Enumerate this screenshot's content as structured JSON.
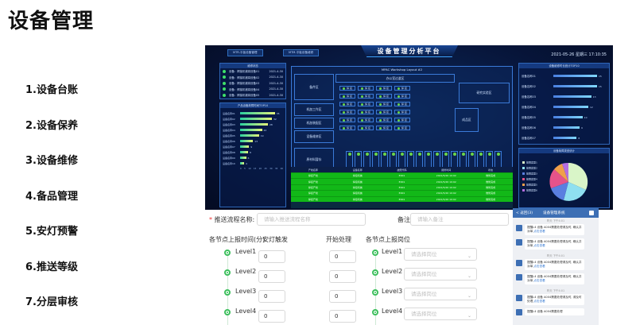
{
  "page_title": "设备管理",
  "menu": [
    "1.设备台账",
    "2.设备保养",
    "3.设备维修",
    "4.备品管理",
    "5.安灯预警",
    "6.推送等级",
    "7.分层审核"
  ],
  "dashboard": {
    "title": "设备管理分析平台",
    "tabs": [
      "MTR-平板设备管理",
      "MTM-平板设备维修"
    ],
    "datetime": "2021-05-26  星期三  17:10:35",
    "left_panel_title": "维修状态",
    "left_rows": [
      {
        "name": "设备：焊接机械臂设备01",
        "date": "2021-4-30"
      },
      {
        "name": "设备：焊接机械臂设备02",
        "date": "2021-4-30"
      },
      {
        "name": "设备：焊接机械臂设备03",
        "date": "2021-4-30"
      },
      {
        "name": "设备：焊接机械臂设备04",
        "date": "2021-4-30"
      },
      {
        "name": "设备：焊接机械臂设备05",
        "date": "2021-4-30"
      }
    ],
    "bar_panel_title": "产品设备故障时间TOP10",
    "bars": [
      {
        "label": "设备名称01",
        "value": 35
      },
      {
        "label": "设备名称02",
        "value": 32
      },
      {
        "label": "设备名称03",
        "value": 28
      },
      {
        "label": "设备名称04",
        "value": 22
      },
      {
        "label": "设备名称05",
        "value": 19
      },
      {
        "label": "设备名称06",
        "value": 13
      },
      {
        "label": "设备名称07",
        "value": 9
      },
      {
        "label": "设备名称08",
        "value": 8
      },
      {
        "label": "设备名称09",
        "value": 6
      },
      {
        "label": "设备名称10",
        "value": 4
      }
    ],
    "bar_axis": [
      "0",
      "5",
      "10",
      "15",
      "20",
      "25",
      "30",
      "35",
      "40"
    ],
    "floor_title": "MPAC Workshop Layout #2",
    "floor_sub": "办公室过道区",
    "zones": [
      "备件区",
      "机加工作区",
      "机加装配区",
      "设备维修区",
      "原材料暂存",
      "成品区",
      "研究实验区"
    ],
    "eq_label": "焊 接",
    "table_title": "设备维修记录",
    "table_head": [
      "产线名称",
      "设备名称",
      "故障代码",
      "报修时间",
      "状态"
    ],
    "table_rows": [
      [
        "焊接产线",
        "焊接机械",
        "E001",
        "2021/5/26 10:02",
        "维修完成"
      ],
      [
        "焊接产线",
        "焊接机械",
        "E001",
        "2021/5/26 10:02",
        "维修完成"
      ],
      [
        "焊接产线",
        "焊接机械",
        "E001",
        "2021/5/26 10:02",
        "维修完成"
      ],
      [
        "焊接产线",
        "焊接机械",
        "E001",
        "2021/5/26 10:02",
        "维修完成"
      ],
      [
        "焊接产线",
        "焊接机械",
        "E001",
        "2021/5/26 10:02",
        "维修完成"
      ]
    ],
    "right_panel_title": "设备维修时长统计TOP10",
    "right_rows": [
      {
        "name": "设备名称01",
        "val": "15"
      },
      {
        "name": "设备名称02",
        "val": "15"
      },
      {
        "name": "设备名称03",
        "val": "13"
      },
      {
        "name": "设备名称04",
        "val": "12"
      },
      {
        "name": "设备名称05",
        "val": "10"
      },
      {
        "name": "设备名称06",
        "val": "9"
      },
      {
        "name": "设备名称07",
        "val": "8"
      }
    ],
    "pie_title": "设备故障类型统计",
    "pie_legend": [
      "故障类型1",
      "故障类型2",
      "故障类型3",
      "故障类型4",
      "故障类型5",
      "故障类型6"
    ]
  },
  "form": {
    "flow_name_label": "推送流程名称:",
    "flow_name_placeholder": "请输入推送流程名称",
    "remark_label": "备注:",
    "remark_placeholder": "请输入备注",
    "col_time": "各节点上报时间(分)",
    "col_trigger": "安灯触发",
    "col_start": "开始处理",
    "col_post": "各节点上报岗位",
    "levels": [
      {
        "label": "Level1",
        "trigger": "0",
        "start": "0"
      },
      {
        "label": "Level2",
        "trigger": "0",
        "start": "0"
      },
      {
        "label": "Level3",
        "trigger": "0",
        "start": "0"
      },
      {
        "label": "Level4",
        "trigger": "0",
        "start": "0"
      }
    ],
    "post_placeholder": "请选择岗位"
  },
  "phone": {
    "back": "< 返回(3)",
    "title": "设备管理系统",
    "timestamps": [
      "昨天 下午4:01",
      "昨天 下午4:01",
      "昨天 下午4:01",
      "昨天 下午4:01"
    ],
    "messages": [
      {
        "text": "提醒L4 设备 A004需要处理请及时, 确认并派单,",
        "link": "点击查看"
      },
      {
        "text": "提醒L4 设备 A004需要处理请及时, 确认并派单,",
        "link": "点击查看"
      },
      {
        "text": "提醒L4 设备 A004需要处理请及时, 确认并派单,",
        "link": "点击查看"
      },
      {
        "text": "提醒L4 设备 A004需要处理请及时, 确认并派单,",
        "link": "点击查看"
      },
      {
        "text": "提醒L4 设备 A004需要处理请及时, 请及时处理,",
        "link": "点击查看"
      },
      {
        "text": "提醒L4 设备 A004需要处理",
        "link": ""
      }
    ]
  }
}
